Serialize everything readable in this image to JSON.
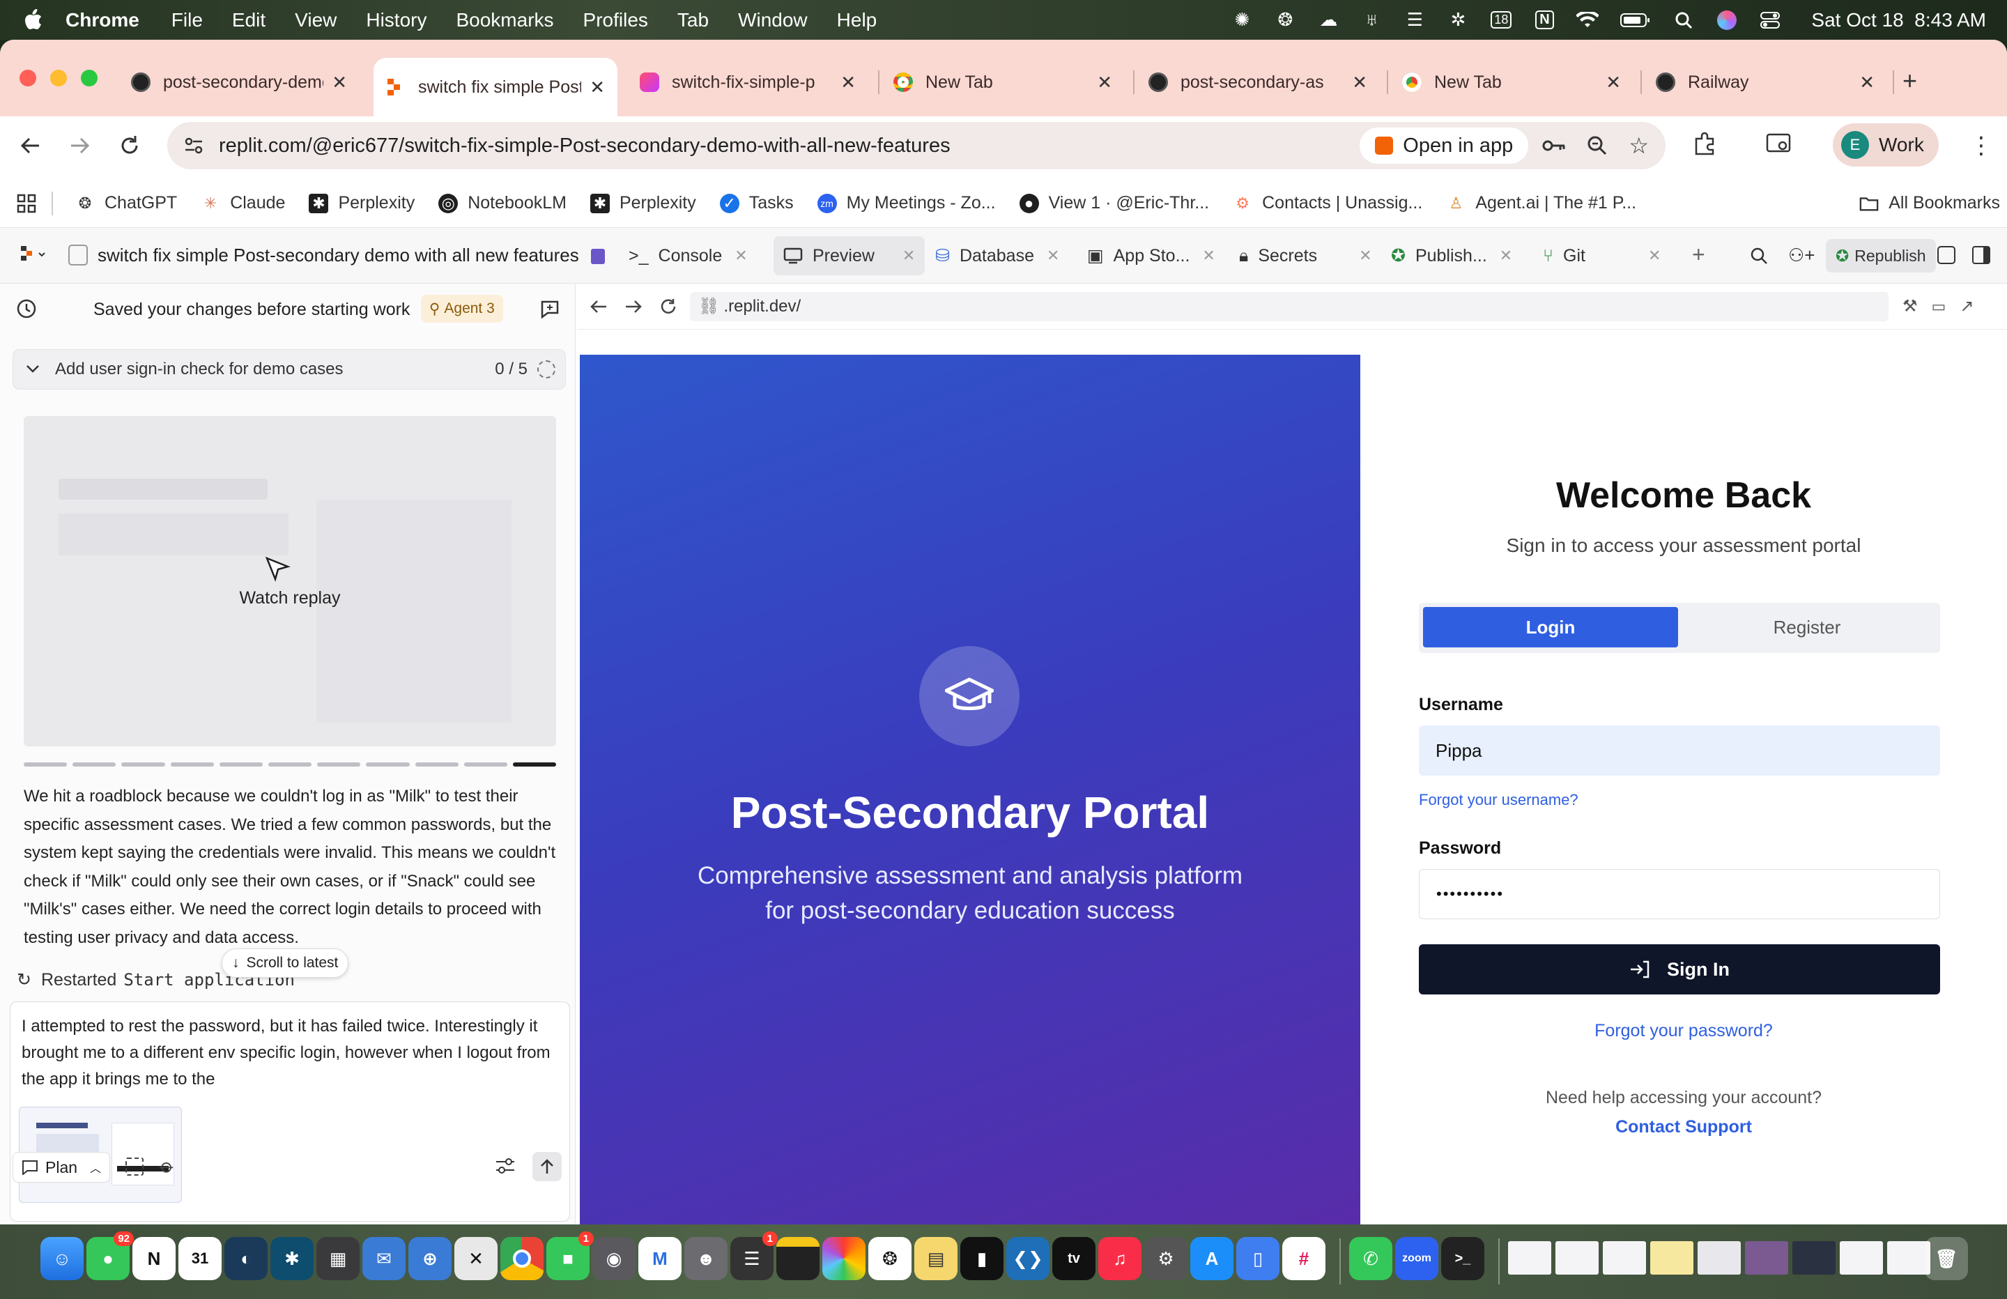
{
  "menubar": {
    "app": "Chrome",
    "items": [
      "File",
      "Edit",
      "View",
      "History",
      "Bookmarks",
      "Profiles",
      "Tab",
      "Window",
      "Help"
    ],
    "datetime": "Sat Oct 18  8:43 AM",
    "battery_badge": "18"
  },
  "tabs": [
    {
      "label": "post-secondary-demo"
    },
    {
      "label": "switch fix simple Post"
    },
    {
      "label": "switch-fix-simple-p"
    },
    {
      "label": "New Tab"
    },
    {
      "label": "post-secondary-as"
    },
    {
      "label": "New Tab"
    },
    {
      "label": "Railway"
    }
  ],
  "omnibox": {
    "url": "replit.com/@eric677/switch-fix-simple-Post-secondary-demo-with-all-new-features",
    "open_in_app": "Open in app",
    "profile": "Work",
    "profile_initial": "E"
  },
  "bookmarks": {
    "items": [
      "ChatGPT",
      "Claude",
      "Perplexity",
      "NotebookLM",
      "Perplexity",
      "Tasks",
      "My Meetings - Zo...",
      "View 1 · @Eric-Thr...",
      "Contacts | Unassig...",
      "Agent.ai | The #1 P..."
    ],
    "all": "All Bookmarks"
  },
  "replit": {
    "project_title": "switch fix simple Post-secondary demo with all new features",
    "tabs": [
      "Console",
      "Preview",
      "Database",
      "App Sto...",
      "Secrets",
      "Publish...",
      "Git"
    ],
    "republish": "Republish"
  },
  "agent_panel": {
    "saved_msg": "Saved your changes before starting work",
    "agent_badge": "Agent 3",
    "plan_title": "Add user sign-in check for demo cases",
    "plan_progress": "0 / 5",
    "watch_replay": "Watch replay",
    "message": "We hit a roadblock because we couldn't log in as \"Milk\" to test their specific assessment cases. We tried a few common passwords, but the system kept saying the credentials were invalid. This means we couldn't check if \"Milk\" could only see their own cases, or if \"Snack\" could see \"Milk's\" cases either. We need the correct login details to proceed with testing user privacy and data access.",
    "scroll_latest": "Scroll to latest",
    "restarted_label": "Restarted",
    "restarted_code": "Start application",
    "input_text": "I attempted to rest the password, but it has failed twice. Interestingly it brought me to a different env specific login, however when I logout from the app it brings me to the",
    "plan_button": "Plan"
  },
  "preview": {
    "url": ".replit.dev/",
    "hero_title": "Post-Secondary Portal",
    "hero_subtitle": "Comprehensive assessment and analysis platform for post-secondary education success",
    "welcome": "Welcome Back",
    "welcome_sub": "Sign in to access your assessment portal",
    "tab_login": "Login",
    "tab_register": "Register",
    "username_label": "Username",
    "username_value": "Pippa",
    "forgot_username": "Forgot your username?",
    "password_label": "Password",
    "password_value": "••••••••••",
    "sign_in": "Sign In",
    "forgot_password": "Forgot your password?",
    "help_text": "Need help accessing your account?",
    "contact_support": "Contact Support"
  },
  "dock": {
    "messages_badge": "92",
    "calendar_day": "31",
    "facetime_badge": "1",
    "reminders_badge": "1"
  },
  "colors": {
    "accent": "#2f5fe0",
    "dark_button": "#0f1629",
    "tabstrip": "#f9d9d2",
    "hero_start": "#2f57cc",
    "hero_end": "#5a2ba8",
    "link": "#2f5fe0"
  },
  "icons": [
    "apple-icon",
    "search-icon",
    "wifi-icon",
    "graduation-cap-icon",
    "sign-in-icon",
    "gear-icon",
    "star-icon",
    "key-icon",
    "zoom-icon",
    "refresh-icon",
    "back-icon",
    "forward-icon"
  ]
}
